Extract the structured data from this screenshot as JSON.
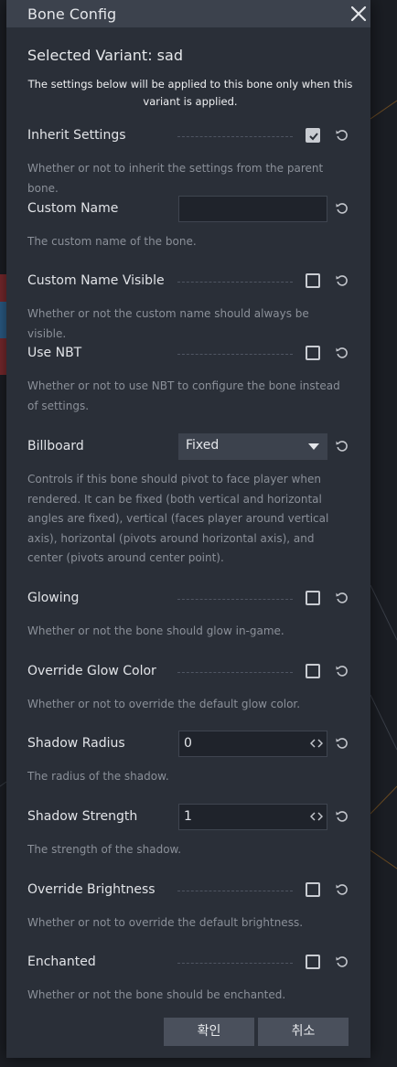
{
  "window": {
    "title": "Bone Config"
  },
  "header": {
    "heading": "Selected Variant: sad",
    "subtitle": "The settings below will be applied to this bone only when this variant is applied."
  },
  "settings": [
    {
      "label": "Inherit Settings",
      "control": "checkbox",
      "checked": true,
      "description": "Whether or not to inherit the settings from the parent bone."
    },
    {
      "label": "Custom Name",
      "control": "text",
      "value": "",
      "description": "The custom name of the bone."
    },
    {
      "label": "Custom Name Visible",
      "control": "checkbox",
      "checked": false,
      "description": "Whether or not the custom name should always be visible."
    },
    {
      "label": "Use NBT",
      "control": "checkbox",
      "checked": false,
      "description": "Whether or not to use NBT to configure the bone instead of settings."
    },
    {
      "label": "Billboard",
      "control": "select",
      "value": "Fixed",
      "description": "Controls if this bone should pivot to face player when rendered. It can be fixed (both vertical and horizontal angles are fixed), vertical (faces player around vertical axis), horizontal (pivots around horizontal axis), and center (pivots around center point)."
    },
    {
      "label": "Glowing",
      "control": "checkbox",
      "checked": false,
      "description": "Whether or not the bone should glow in-game."
    },
    {
      "label": "Override Glow Color",
      "control": "checkbox",
      "checked": false,
      "description": "Whether or not to override the default glow color."
    },
    {
      "label": "Shadow Radius",
      "control": "number",
      "value": "0",
      "description": "The radius of the shadow."
    },
    {
      "label": "Shadow Strength",
      "control": "number",
      "value": "1",
      "description": "The strength of the shadow."
    },
    {
      "label": "Override Brightness",
      "control": "checkbox",
      "checked": false,
      "description": "Whether or not to override the default brightness."
    },
    {
      "label": "Enchanted",
      "control": "checkbox",
      "checked": false,
      "description": "Whether or not the bone should be enchanted."
    }
  ],
  "footer": {
    "confirm_label": "확인",
    "cancel_label": "취소"
  },
  "icons": {
    "close": "close-icon",
    "reset": "reset-icon",
    "check": "checkmark-icon",
    "dropdown": "caret-down-icon",
    "spinner": "spinner-arrows-icon"
  },
  "colors": {
    "panel": "#2a2f38",
    "titlebar": "#3c424d",
    "button": "#4a505c",
    "input": "#1f232b"
  }
}
